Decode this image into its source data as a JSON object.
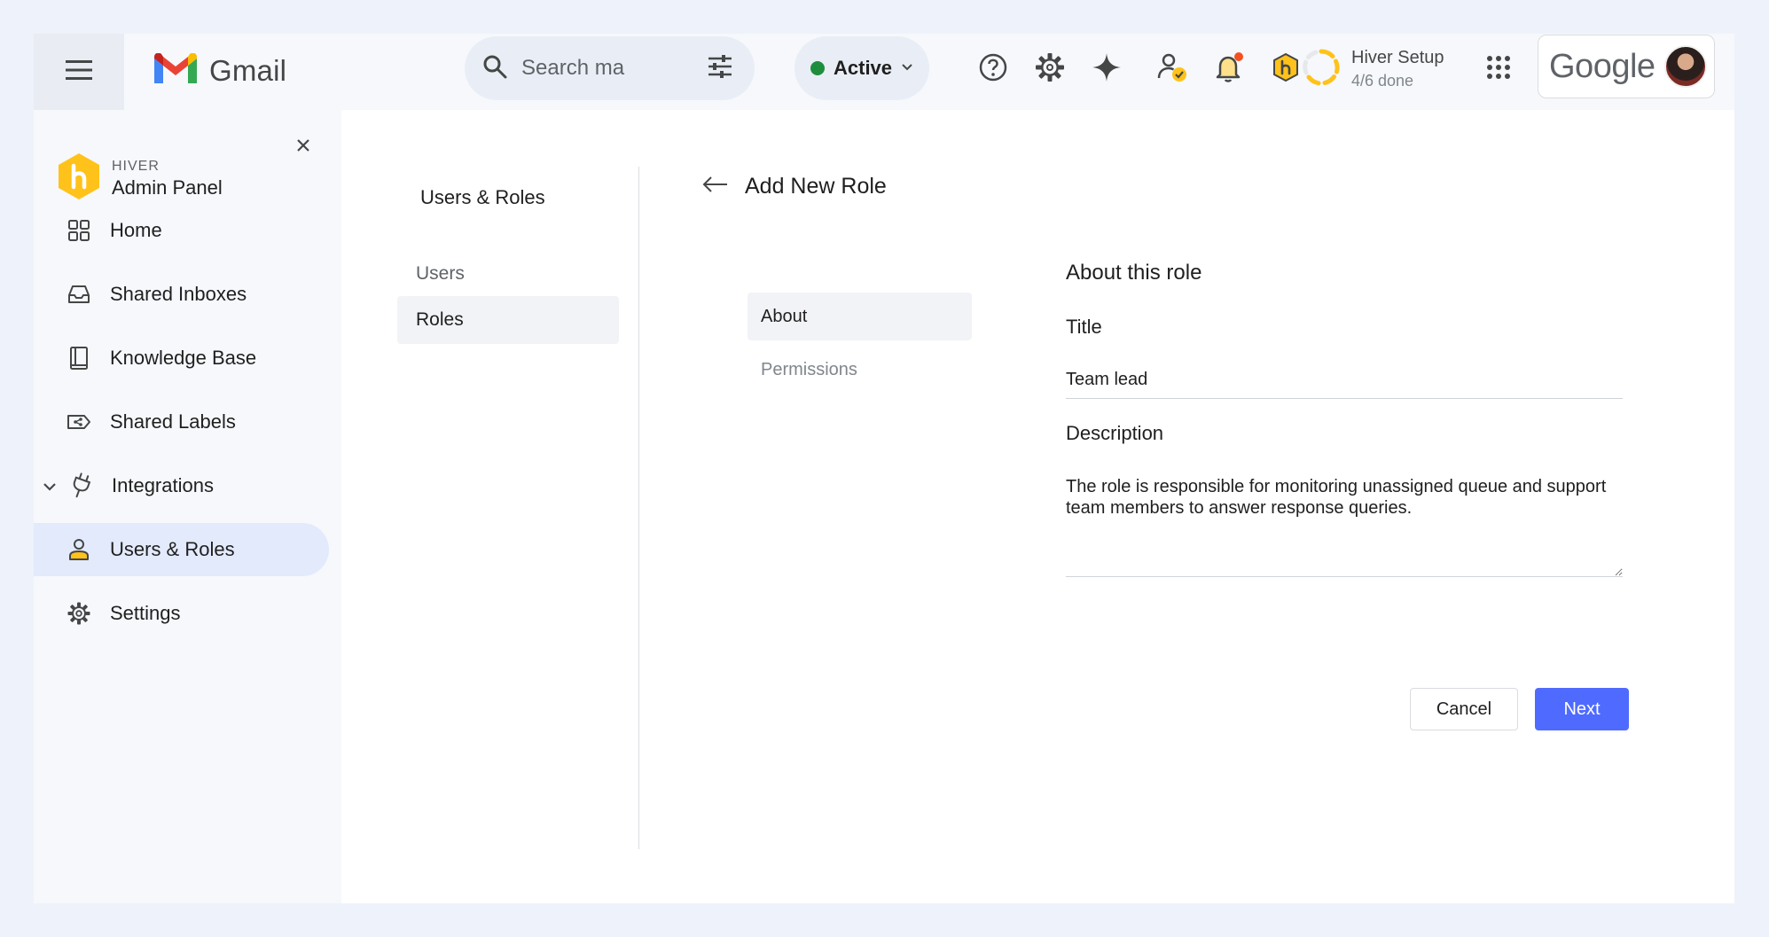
{
  "topbar": {
    "app_name": "Gmail",
    "search_placeholder": "Search ma",
    "status_label": "Active",
    "setup_title": "Hiver Setup",
    "setup_progress": "4/6 done",
    "setup_progress_fraction": 0.67,
    "account_brand": "Google",
    "icons": [
      "menu-icon",
      "search-icon",
      "filter-sliders-icon",
      "chevron-down-icon",
      "help-icon",
      "settings-gear-icon",
      "sparkle-icon",
      "user-check-icon",
      "bell-icon",
      "hiver-shield-icon",
      "apps-grid-icon"
    ]
  },
  "sidebar": {
    "brand_small": "HIVER",
    "brand_title": "Admin Panel",
    "items": [
      {
        "label": "Home",
        "icon": "grid-icon"
      },
      {
        "label": "Shared Inboxes",
        "icon": "inbox-icon"
      },
      {
        "label": "Knowledge Base",
        "icon": "book-icon"
      },
      {
        "label": "Shared Labels",
        "icon": "label-share-icon"
      },
      {
        "label": "Integrations",
        "icon": "plug-icon"
      },
      {
        "label": "Users & Roles",
        "icon": "person-icon",
        "active": true
      },
      {
        "label": "Settings",
        "icon": "gear-icon"
      }
    ]
  },
  "subnav": {
    "title": "Users & Roles",
    "items": [
      {
        "label": "Users"
      },
      {
        "label": "Roles",
        "active": true
      }
    ]
  },
  "page": {
    "title": "Add New Role",
    "steps": [
      {
        "label": "About",
        "active": true
      },
      {
        "label": "Permissions"
      }
    ]
  },
  "form": {
    "section_title": "About this role",
    "title_label": "Title",
    "title_value": "Team lead",
    "description_label": "Description",
    "description_value": "The role is responsible for monitoring unassigned queue and support team members to answer response queries.",
    "cancel_label": "Cancel",
    "next_label": "Next"
  },
  "colors": {
    "primary_button": "#4f6bff",
    "active_status": "#1e8e3e",
    "hiver_yellow": "#ffc21a",
    "notification_dot": "#f4511e",
    "active_nav_bg": "#e3eafc"
  }
}
